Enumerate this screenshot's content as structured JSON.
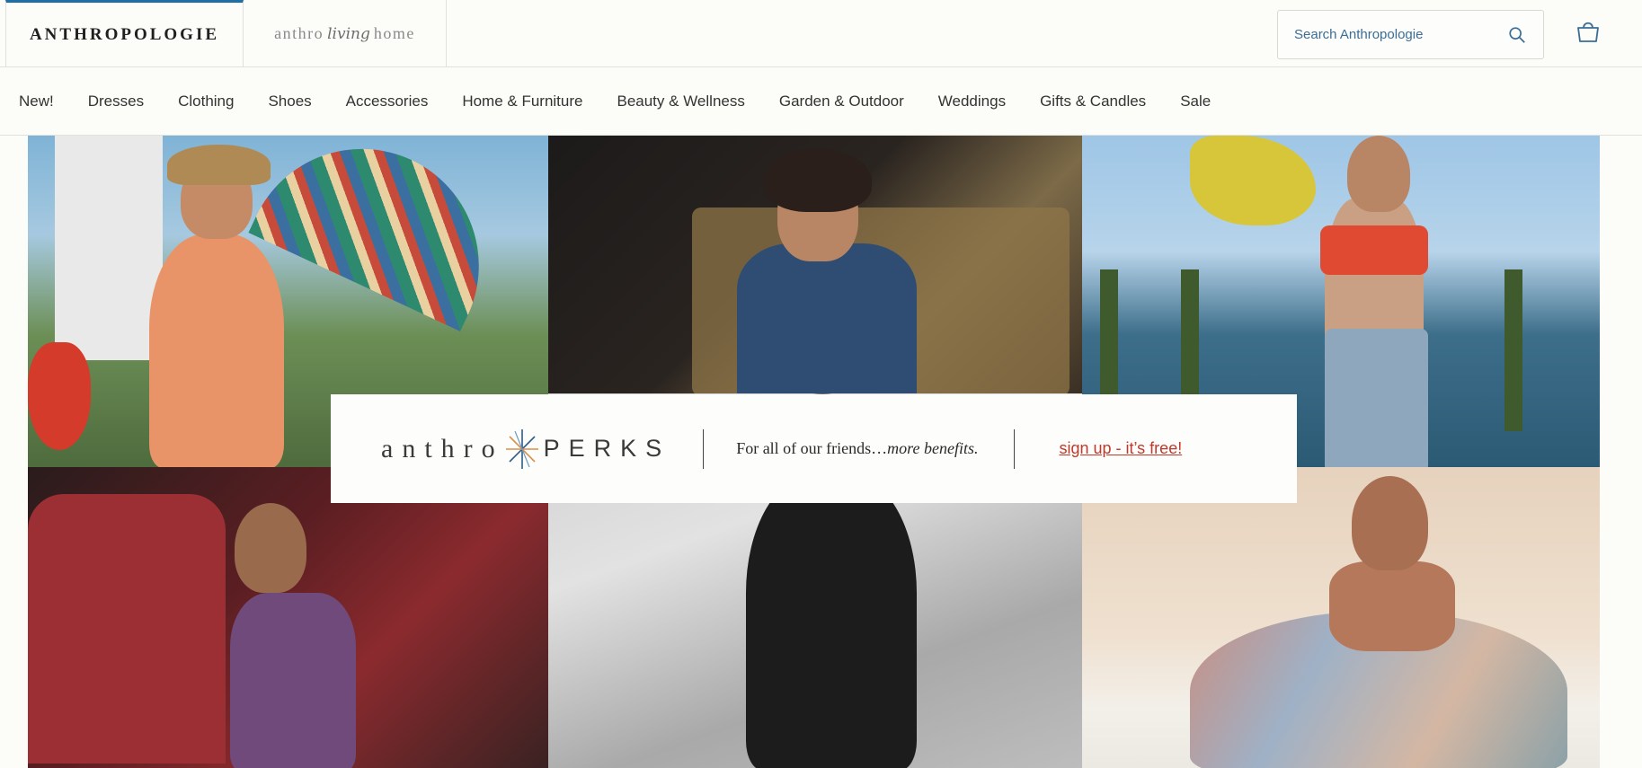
{
  "header": {
    "brand_primary": "ANTHROPOLOGIE",
    "brand_living_left": "anthro",
    "brand_living_script": "living",
    "brand_living_right": "home",
    "search": {
      "placeholder": "Search Anthropologie",
      "value": ""
    },
    "icons": {
      "search": "search-icon",
      "cart": "shopping-bag-icon"
    },
    "accent_color": "#1d6fa5"
  },
  "nav": {
    "items": [
      {
        "label": "New!"
      },
      {
        "label": "Dresses"
      },
      {
        "label": "Clothing"
      },
      {
        "label": "Shoes"
      },
      {
        "label": "Accessories"
      },
      {
        "label": "Home & Furniture"
      },
      {
        "label": "Beauty & Wellness"
      },
      {
        "label": "Garden & Outdoor"
      },
      {
        "label": "Weddings"
      },
      {
        "label": "Gifts & Candles"
      },
      {
        "label": "Sale"
      }
    ]
  },
  "promo": {
    "logo_left": "anthro",
    "logo_right": "PERKS",
    "tagline_main": "For all of our friends",
    "tagline_em": "more benefits.",
    "tagline_separator": "…",
    "cta": "sign up - it’s free!",
    "cta_color": "#c0392b"
  },
  "hero": {
    "tiles": [
      {
        "name": "hero-tile-1"
      },
      {
        "name": "hero-tile-2"
      },
      {
        "name": "hero-tile-3"
      },
      {
        "name": "hero-tile-4"
      },
      {
        "name": "hero-tile-5"
      },
      {
        "name": "hero-tile-6"
      }
    ]
  }
}
